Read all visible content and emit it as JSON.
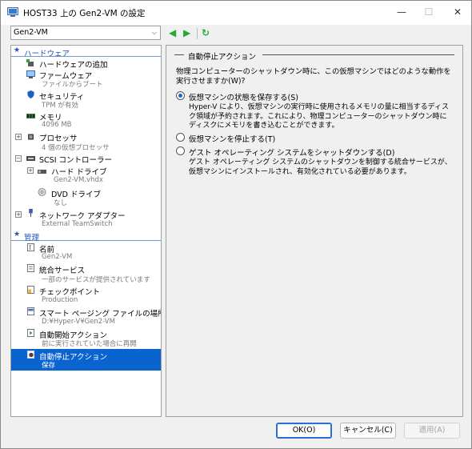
{
  "window": {
    "title": "HOST33 上の Gen2-VM の設定"
  },
  "titlebar": {
    "min_glyph": "—",
    "max_glyph": "☐",
    "close_glyph": "✕"
  },
  "toolbar": {
    "vm_selected": "Gen2-VM",
    "back_glyph": "◀",
    "forward_glyph": "▶",
    "refresh_glyph": "↻"
  },
  "sections": {
    "hardware": "ハードウェア",
    "management": "管理"
  },
  "hardware_items": [
    {
      "label": "ハードウェアの追加",
      "sub": ""
    },
    {
      "label": "ファームウェア",
      "sub": "ファイルからブート"
    },
    {
      "label": "セキュリティ",
      "sub": "TPM が有効"
    },
    {
      "label": "メモリ",
      "sub": "4096 MB"
    },
    {
      "label": "プロセッサ",
      "sub": "4 個の仮想プロセッサ"
    },
    {
      "label": "SCSI コントローラー",
      "sub": ""
    },
    {
      "label": "ハード ドライブ",
      "sub": "Gen2-VM.vhdx"
    },
    {
      "label": "DVD ドライブ",
      "sub": "なし"
    },
    {
      "label": "ネットワーク アダプター",
      "sub": "External TeamSwitch"
    }
  ],
  "management_items": [
    {
      "label": "名前",
      "sub": "Gen2-VM"
    },
    {
      "label": "統合サービス",
      "sub": "一部のサービスが提供されています"
    },
    {
      "label": "チェックポイント",
      "sub": "Production"
    },
    {
      "label": "スマート ページング ファイルの場所",
      "sub": "D:¥Hyper-V¥Gen2-VM"
    },
    {
      "label": "自動開始アクション",
      "sub": "前に実行されていた場合に再開"
    },
    {
      "label": "自動停止アクション",
      "sub": "保存"
    }
  ],
  "panel": {
    "group_title": "自動停止アクション",
    "question": "物理コンピューターのシャットダウン時に、この仮想マシンではどのような動作を実行させますか(W)?",
    "options": [
      {
        "label": "仮想マシンの状態を保存する(S)",
        "selected": true,
        "desc": "Hyper-V により、仮想マシンの実行時に使用されるメモリの量に相当するディスク領域が予約されます。これにより、物理コンピューターのシャットダウン時にディスクにメモリを書き込むことができます。"
      },
      {
        "label": "仮想マシンを停止する(T)",
        "selected": false,
        "desc": ""
      },
      {
        "label": "ゲスト オペレーティング システムをシャットダウンする(D)",
        "selected": false,
        "desc": "ゲスト オペレーティング システムのシャットダウンを制御する統合サービスが、仮想マシンにインストールされ、有効化されている必要があります。"
      }
    ]
  },
  "buttons": {
    "ok": "OK(O)",
    "cancel": "キャンセル(C)",
    "apply": "適用(A)"
  },
  "colors": {
    "accent": "#0a64d0",
    "nav_green": "#2aa836",
    "section_blue": "#1f55b5"
  }
}
